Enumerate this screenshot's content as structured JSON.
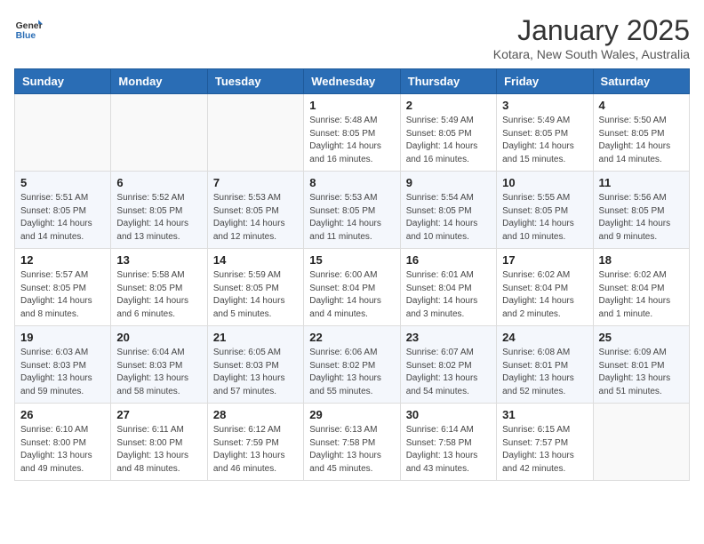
{
  "header": {
    "logo_text_general": "General",
    "logo_text_blue": "Blue",
    "month_year": "January 2025",
    "location": "Kotara, New South Wales, Australia"
  },
  "days_of_week": [
    "Sunday",
    "Monday",
    "Tuesday",
    "Wednesday",
    "Thursday",
    "Friday",
    "Saturday"
  ],
  "weeks": [
    [
      {
        "day": "",
        "info": ""
      },
      {
        "day": "",
        "info": ""
      },
      {
        "day": "",
        "info": ""
      },
      {
        "day": "1",
        "info": "Sunrise: 5:48 AM\nSunset: 8:05 PM\nDaylight: 14 hours\nand 16 minutes."
      },
      {
        "day": "2",
        "info": "Sunrise: 5:49 AM\nSunset: 8:05 PM\nDaylight: 14 hours\nand 16 minutes."
      },
      {
        "day": "3",
        "info": "Sunrise: 5:49 AM\nSunset: 8:05 PM\nDaylight: 14 hours\nand 15 minutes."
      },
      {
        "day": "4",
        "info": "Sunrise: 5:50 AM\nSunset: 8:05 PM\nDaylight: 14 hours\nand 14 minutes."
      }
    ],
    [
      {
        "day": "5",
        "info": "Sunrise: 5:51 AM\nSunset: 8:05 PM\nDaylight: 14 hours\nand 14 minutes."
      },
      {
        "day": "6",
        "info": "Sunrise: 5:52 AM\nSunset: 8:05 PM\nDaylight: 14 hours\nand 13 minutes."
      },
      {
        "day": "7",
        "info": "Sunrise: 5:53 AM\nSunset: 8:05 PM\nDaylight: 14 hours\nand 12 minutes."
      },
      {
        "day": "8",
        "info": "Sunrise: 5:53 AM\nSunset: 8:05 PM\nDaylight: 14 hours\nand 11 minutes."
      },
      {
        "day": "9",
        "info": "Sunrise: 5:54 AM\nSunset: 8:05 PM\nDaylight: 14 hours\nand 10 minutes."
      },
      {
        "day": "10",
        "info": "Sunrise: 5:55 AM\nSunset: 8:05 PM\nDaylight: 14 hours\nand 10 minutes."
      },
      {
        "day": "11",
        "info": "Sunrise: 5:56 AM\nSunset: 8:05 PM\nDaylight: 14 hours\nand 9 minutes."
      }
    ],
    [
      {
        "day": "12",
        "info": "Sunrise: 5:57 AM\nSunset: 8:05 PM\nDaylight: 14 hours\nand 8 minutes."
      },
      {
        "day": "13",
        "info": "Sunrise: 5:58 AM\nSunset: 8:05 PM\nDaylight: 14 hours\nand 6 minutes."
      },
      {
        "day": "14",
        "info": "Sunrise: 5:59 AM\nSunset: 8:05 PM\nDaylight: 14 hours\nand 5 minutes."
      },
      {
        "day": "15",
        "info": "Sunrise: 6:00 AM\nSunset: 8:04 PM\nDaylight: 14 hours\nand 4 minutes."
      },
      {
        "day": "16",
        "info": "Sunrise: 6:01 AM\nSunset: 8:04 PM\nDaylight: 14 hours\nand 3 minutes."
      },
      {
        "day": "17",
        "info": "Sunrise: 6:02 AM\nSunset: 8:04 PM\nDaylight: 14 hours\nand 2 minutes."
      },
      {
        "day": "18",
        "info": "Sunrise: 6:02 AM\nSunset: 8:04 PM\nDaylight: 14 hours\nand 1 minute."
      }
    ],
    [
      {
        "day": "19",
        "info": "Sunrise: 6:03 AM\nSunset: 8:03 PM\nDaylight: 13 hours\nand 59 minutes."
      },
      {
        "day": "20",
        "info": "Sunrise: 6:04 AM\nSunset: 8:03 PM\nDaylight: 13 hours\nand 58 minutes."
      },
      {
        "day": "21",
        "info": "Sunrise: 6:05 AM\nSunset: 8:03 PM\nDaylight: 13 hours\nand 57 minutes."
      },
      {
        "day": "22",
        "info": "Sunrise: 6:06 AM\nSunset: 8:02 PM\nDaylight: 13 hours\nand 55 minutes."
      },
      {
        "day": "23",
        "info": "Sunrise: 6:07 AM\nSunset: 8:02 PM\nDaylight: 13 hours\nand 54 minutes."
      },
      {
        "day": "24",
        "info": "Sunrise: 6:08 AM\nSunset: 8:01 PM\nDaylight: 13 hours\nand 52 minutes."
      },
      {
        "day": "25",
        "info": "Sunrise: 6:09 AM\nSunset: 8:01 PM\nDaylight: 13 hours\nand 51 minutes."
      }
    ],
    [
      {
        "day": "26",
        "info": "Sunrise: 6:10 AM\nSunset: 8:00 PM\nDaylight: 13 hours\nand 49 minutes."
      },
      {
        "day": "27",
        "info": "Sunrise: 6:11 AM\nSunset: 8:00 PM\nDaylight: 13 hours\nand 48 minutes."
      },
      {
        "day": "28",
        "info": "Sunrise: 6:12 AM\nSunset: 7:59 PM\nDaylight: 13 hours\nand 46 minutes."
      },
      {
        "day": "29",
        "info": "Sunrise: 6:13 AM\nSunset: 7:58 PM\nDaylight: 13 hours\nand 45 minutes."
      },
      {
        "day": "30",
        "info": "Sunrise: 6:14 AM\nSunset: 7:58 PM\nDaylight: 13 hours\nand 43 minutes."
      },
      {
        "day": "31",
        "info": "Sunrise: 6:15 AM\nSunset: 7:57 PM\nDaylight: 13 hours\nand 42 minutes."
      },
      {
        "day": "",
        "info": ""
      }
    ]
  ]
}
